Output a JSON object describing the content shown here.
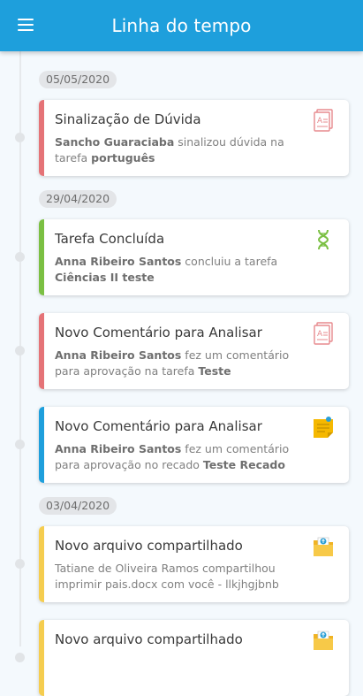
{
  "header": {
    "title": "Linha do tempo",
    "menu_icon": "hamburger-menu-icon"
  },
  "colors": {
    "primary": "#1e9fdc",
    "red": "#e57377",
    "green": "#7bc043",
    "blue": "#1e9fdc",
    "yellow": "#f5cd4f"
  },
  "groups": [
    {
      "date": "05/05/2020",
      "items": [
        {
          "title": "Sinalização de Dúvida",
          "actor": "Sancho Guaraciaba",
          "text": " sinalizou dúvida na tarefa ",
          "target": "português",
          "icon": "document-a-icon",
          "color": "red"
        }
      ]
    },
    {
      "date": "29/04/2020",
      "items": [
        {
          "title": "Tarefa Concluída",
          "actor": "Anna Ribeiro Santos",
          "text": " concluiu a tarefa ",
          "target": "Ciências II teste",
          "icon": "dna-icon",
          "color": "green"
        },
        {
          "title": "Novo Comentário para Analisar",
          "actor": "Anna Ribeiro Santos",
          "text": " fez um comentário para aprovação na tarefa ",
          "target": "Teste",
          "icon": "document-a-icon",
          "color": "red"
        },
        {
          "title": "Novo Comentário para Analisar",
          "actor": "Anna Ribeiro Santos",
          "text": " fez um comentário para aprovação no recado ",
          "target": "Teste Recado",
          "icon": "sticky-note-icon",
          "color": "blue"
        }
      ]
    },
    {
      "date": "03/04/2020",
      "items": [
        {
          "title": "Novo arquivo compartilhado",
          "actor": "",
          "text": "Tatiane de Oliveira Ramos compartilhou imprimir pais.docx com você - llkjhgjbnb",
          "target": "",
          "icon": "shared-folder-icon",
          "color": "yellow"
        },
        {
          "title": "Novo arquivo compartilhado",
          "actor": "",
          "text": "",
          "target": "",
          "icon": "shared-folder-icon",
          "color": "yellow"
        }
      ]
    }
  ]
}
